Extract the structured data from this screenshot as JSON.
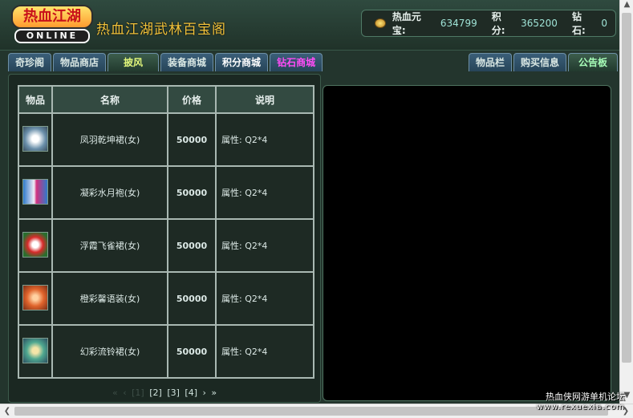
{
  "header": {
    "logo_top": "热血江湖",
    "logo_bottom": "ONLINE",
    "site_title": "热血江湖武林百宝阁",
    "wallet": {
      "yuanbao_label": "热血元宝:",
      "yuanbao_value": "634799",
      "points_label": "积分:",
      "points_value": "365200",
      "diamond_label": "钻石:",
      "diamond_value": "0"
    }
  },
  "tabs_left": [
    "奇珍阁",
    "物品商店",
    "披风",
    "装备商城",
    "积分商城",
    "钻石商城"
  ],
  "tabs_right": [
    "物品栏",
    "购买信息",
    "公告板"
  ],
  "table": {
    "headers": [
      "物品",
      "名称",
      "价格",
      "说明"
    ],
    "rows": [
      {
        "name": "凤羽乾坤裙(女)",
        "price": "50000",
        "desc": "属性: Q2*4"
      },
      {
        "name": "凝彩水月袍(女)",
        "price": "50000",
        "desc": "属性: Q2*4"
      },
      {
        "name": "浮霞飞雀裙(女)",
        "price": "50000",
        "desc": "属性: Q2*4"
      },
      {
        "name": "橙彩馨语装(女)",
        "price": "50000",
        "desc": "属性: Q2*4"
      },
      {
        "name": "幻彩流铃裙(女)",
        "price": "50000",
        "desc": "属性: Q2*4"
      }
    ]
  },
  "pager": {
    "dim_first": "«",
    "dim_prev": "‹",
    "current": "[1]",
    "pages": [
      "[2]",
      "[3]",
      "[4]"
    ],
    "next": "›",
    "last": "»"
  },
  "watermark": {
    "line1": "热血侠网游单机论坛",
    "line2": "www.rexuexia.com"
  },
  "colors": {
    "accent_gold": "#f2c23a",
    "diamond_tab": "#ff4cf6",
    "active_tab": "#e2f77b",
    "price": "#9fe3d6"
  }
}
